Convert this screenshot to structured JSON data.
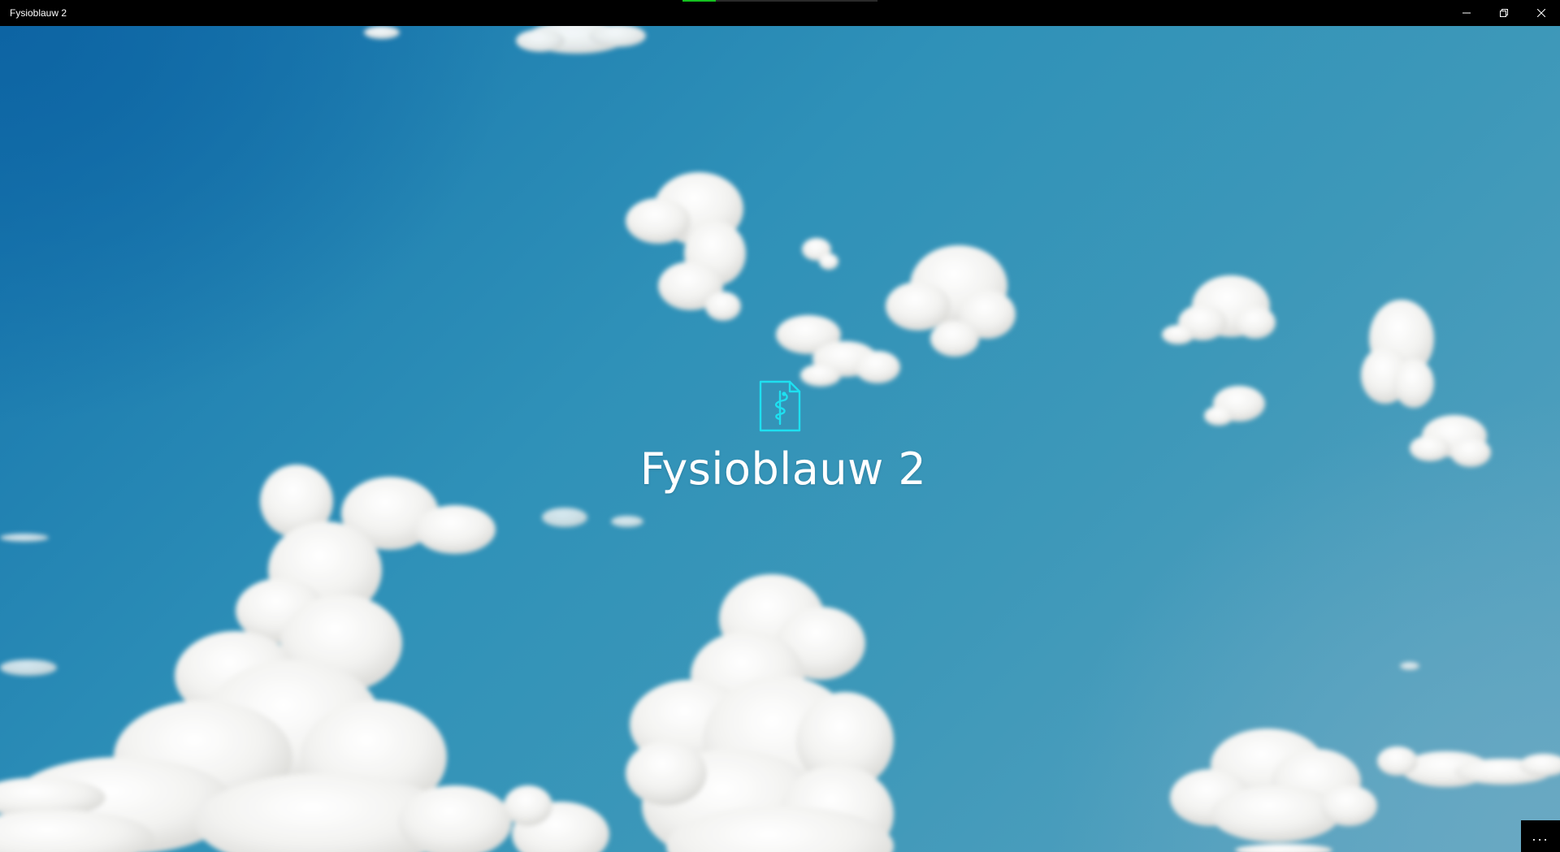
{
  "window": {
    "title": "Fysioblauw 2",
    "loading_progress": 0.17,
    "accent_color": "#14c21f"
  },
  "caption_buttons": {
    "minimize_icon": "minimize-icon",
    "restore_icon": "restore-icon",
    "close_icon": "close-icon"
  },
  "splash": {
    "icon": "document-caduceus-icon",
    "icon_color": "#1ee0f0",
    "app_name": "Fysioblauw 2"
  },
  "more_button": {
    "label": "...",
    "icon": "more-icon"
  }
}
